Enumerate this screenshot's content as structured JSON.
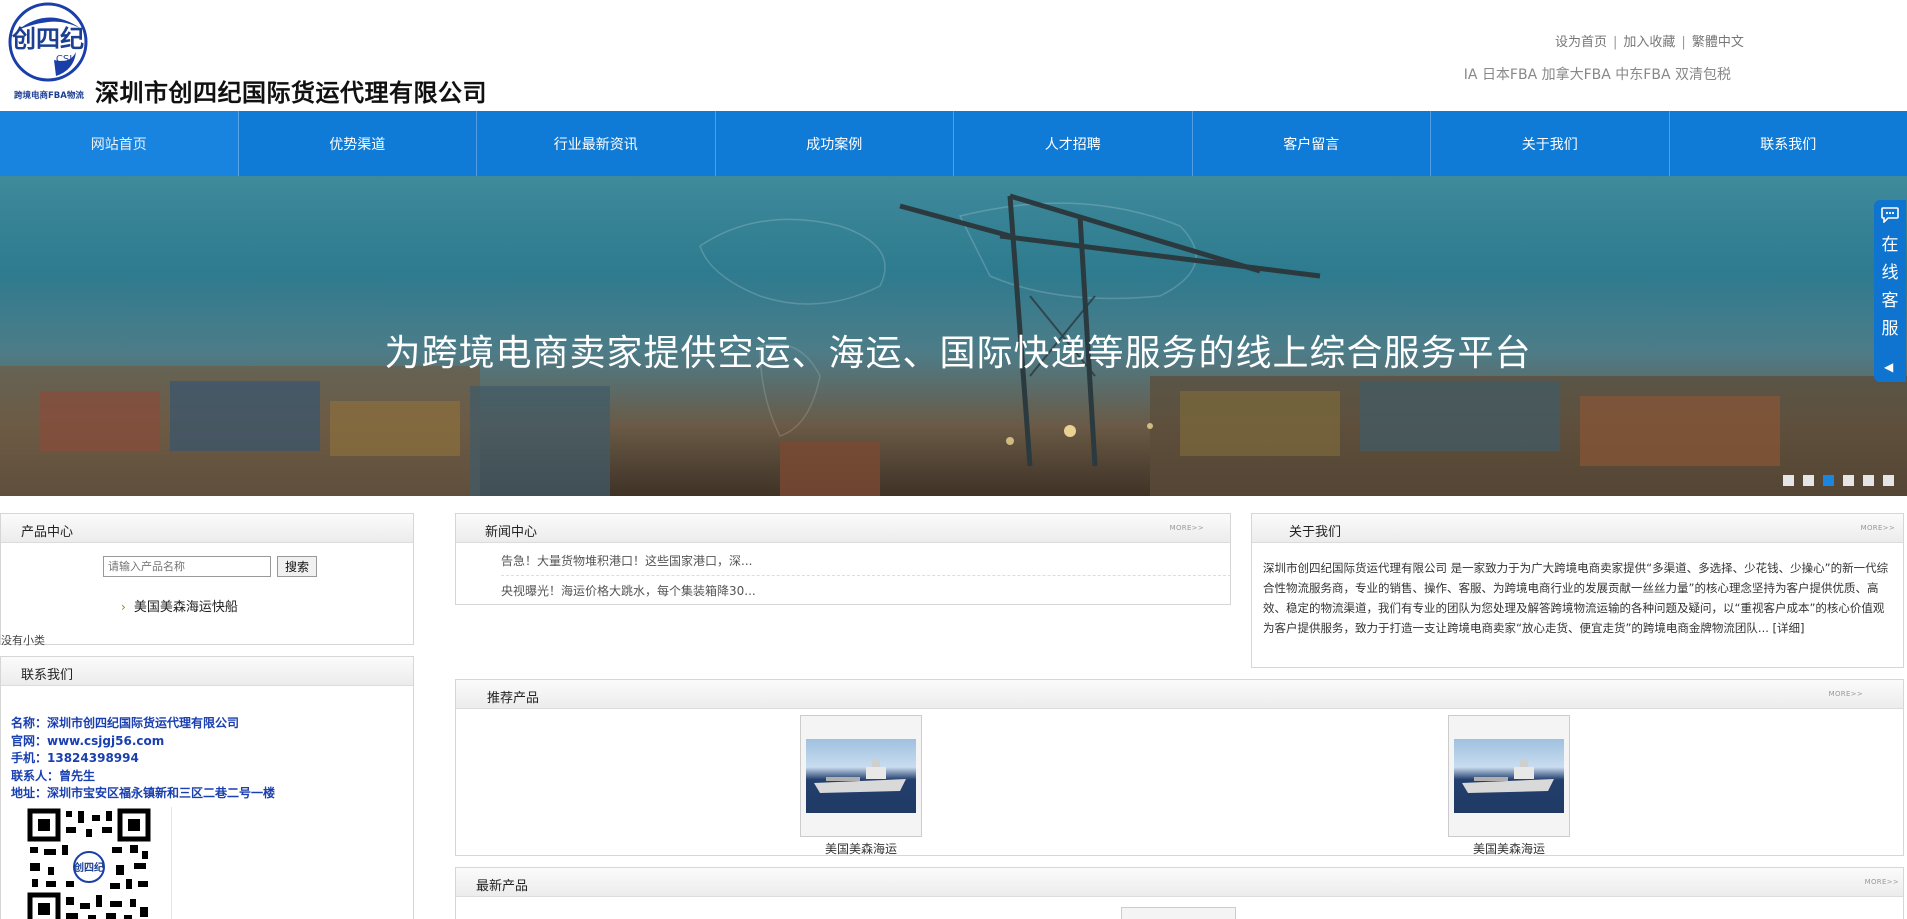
{
  "header": {
    "logo_text": "创四纪",
    "logo_sub": "CSJ",
    "logo_caption": "跨境电商FBA物流",
    "company_name": "深圳市创四纪国际货运代理有限公司",
    "top_links": [
      "设为首页",
      "加入收藏",
      "繁體中文"
    ],
    "marquee": "IA 日本FBA 加拿大FBA 中东FBA 双清包税"
  },
  "nav": {
    "items": [
      "网站首页",
      "优势渠道",
      "行业最新资讯",
      "成功案例",
      "人才招聘",
      "客户留言",
      "关于我们",
      "联系我们"
    ]
  },
  "banner": {
    "slogan": "为跨境电商卖家提供空运、海运、国际快递等服务的线上综合服务平台",
    "dot_count": 6,
    "active_dot": 3
  },
  "service": {
    "text": [
      "在",
      "线",
      "客",
      "服"
    ],
    "arrow": "◀",
    "chat_icon": "chat-bubble-icon"
  },
  "products_panel": {
    "title": "产品中心",
    "search_placeholder": "请输入产品名称",
    "search_button": "搜索",
    "category": "美国美森海运快船",
    "no_sub": "没有小类"
  },
  "contact_panel": {
    "title": "联系我们",
    "lines": [
      "名称：深圳市创四纪国际货运代理有限公司",
      "官网：www.csjgj56.com",
      "手机：13824398994",
      "联系人：曾先生",
      "地址：深圳市宝安区福永镇新和三区二巷二号一楼"
    ]
  },
  "news_panel": {
    "title": "新闻中心",
    "more": "MORE>>",
    "items": [
      "告急！大量货物堆积港口！这些国家港口，深...",
      "央视曝光！海运价格大跳水，每个集装箱降30..."
    ]
  },
  "about_panel": {
    "title": "关于我们",
    "more": "MORE>>",
    "text": "深圳市创四纪国际货运代理有限公司 是一家致力于为广大跨境电商卖家提供“多渠道、多选择、少花钱、少操心”的新一代综合性物流服务商，专业的销售、操作、客服、为跨境电商行业的发展贡献一丝丝力量”的核心理念坚持为客户提供优质、高效、稳定的物流渠道，我们有专业的团队为您处理及解答跨境物流运输的各种问题及疑问，以“重视客户成本”的核心价值观为客户提供服务，致力于打造一支让跨境电商卖家“放心走货、便宜走货”的跨境电商金牌物流团队...",
    "detail_link": "[详细]"
  },
  "recommended": {
    "title": "推荐产品",
    "more": "MORE>>",
    "items": [
      "美国美森海运",
      "美国美森海运"
    ]
  },
  "latest": {
    "title": "最新产品",
    "more": "MORE>>"
  },
  "colors": {
    "nav_blue": "#0f7bd6",
    "contact_blue": "#1a3fb0",
    "active_dot": "#1a86df"
  }
}
